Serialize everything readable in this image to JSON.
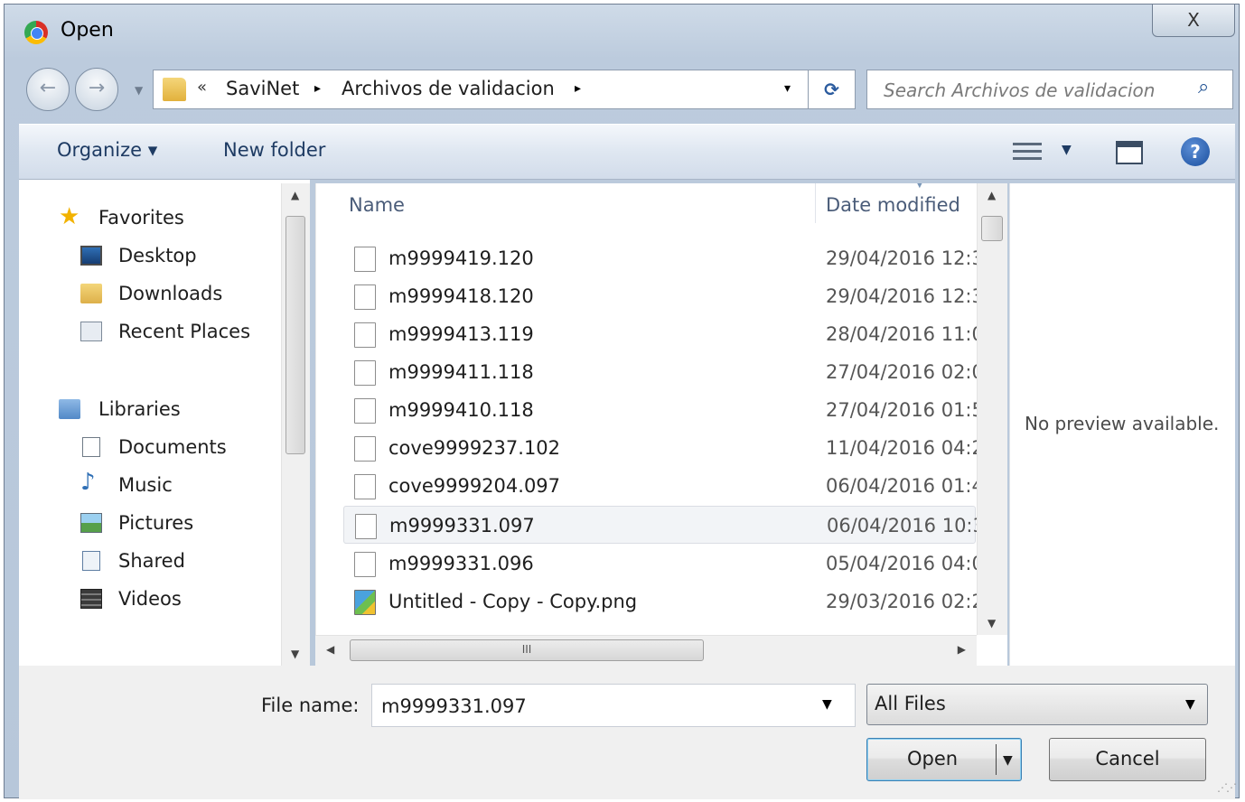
{
  "window": {
    "title": "Open",
    "close_glyph": "X"
  },
  "address": {
    "breadcrumb_prefix": "«",
    "breadcrumbs": [
      "SaviNet",
      "Archivos de validacion"
    ],
    "separator": "▸",
    "dropdown_glyph": "▾",
    "refresh_glyph": "⟳"
  },
  "search": {
    "placeholder": "Search Archivos de validacion",
    "icon_glyph": "⌕"
  },
  "toolbar": {
    "organize_label": "Organize ▾",
    "new_folder_label": "New folder",
    "help_glyph": "?"
  },
  "nav": {
    "favorites": {
      "label": "Favorites",
      "items": [
        "Desktop",
        "Downloads",
        "Recent Places"
      ]
    },
    "libraries": {
      "label": "Libraries",
      "items": [
        "Documents",
        "Music",
        "Pictures",
        "Shared",
        "Videos"
      ]
    }
  },
  "file_list": {
    "columns": {
      "name": "Name",
      "date": "Date modified"
    },
    "rows": [
      {
        "name": "m9999419.120",
        "date": "29/04/2016 12:3",
        "type": "file"
      },
      {
        "name": "m9999418.120",
        "date": "29/04/2016 12:3",
        "type": "file"
      },
      {
        "name": "m9999413.119",
        "date": "28/04/2016 11:0",
        "type": "file"
      },
      {
        "name": "m9999411.118",
        "date": "27/04/2016 02:0",
        "type": "file"
      },
      {
        "name": "m9999410.118",
        "date": "27/04/2016 01:5",
        "type": "file"
      },
      {
        "name": "cove9999237.102",
        "date": "11/04/2016 04:2",
        "type": "file"
      },
      {
        "name": "cove9999204.097",
        "date": "06/04/2016 01:4",
        "type": "file"
      },
      {
        "name": "m9999331.097",
        "date": "06/04/2016 10:3",
        "type": "file",
        "selected": true
      },
      {
        "name": "m9999331.096",
        "date": "05/04/2016 04:0",
        "type": "file"
      },
      {
        "name": "Untitled - Copy - Copy.png",
        "date": "29/03/2016 02:2",
        "type": "image"
      }
    ],
    "hscroll_grip": "III"
  },
  "preview": {
    "message": "No preview available."
  },
  "footer": {
    "filename_label": "File name:",
    "filename_value": "m9999331.097",
    "filetype_value": "All Files",
    "open_label": "Open",
    "cancel_label": "Cancel"
  },
  "icons": {
    "favorites": "star-icon",
    "desktop": "desktop-icon",
    "downloads": "downloads-folder-icon",
    "recent": "recent-places-icon",
    "libraries": "library-icon",
    "documents": "documents-icon",
    "music": "music-note-icon",
    "pictures": "pictures-icon",
    "shared": "shared-icon",
    "videos": "film-icon"
  }
}
